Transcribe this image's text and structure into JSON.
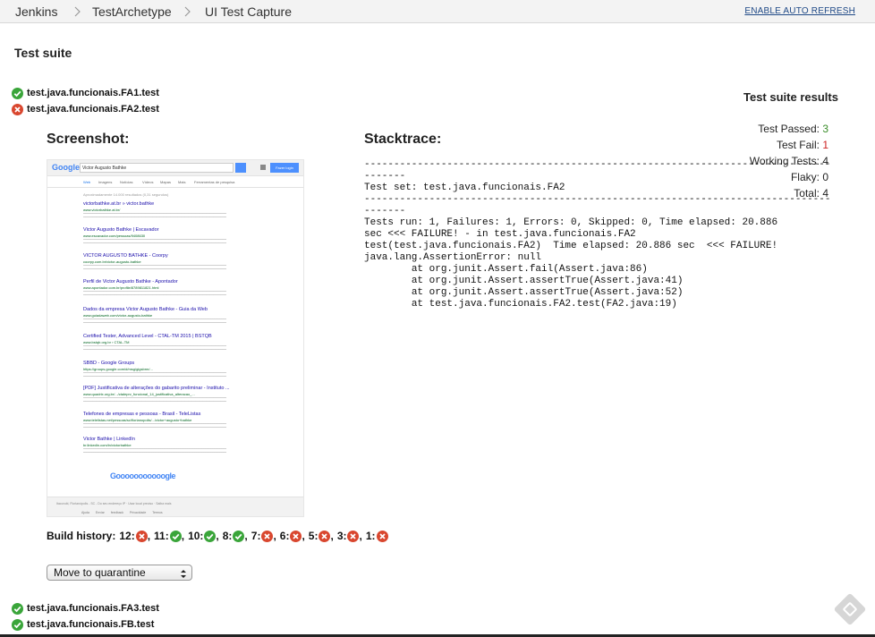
{
  "breadcrumb": {
    "items": [
      "Jenkins",
      "TestArchetype",
      "UI Test Capture"
    ],
    "auto_refresh": "ENABLE AUTO REFRESH"
  },
  "page": {
    "title": "Test suite"
  },
  "tests": [
    {
      "name": "test.java.funcionais.FA1.test",
      "status": "pass"
    },
    {
      "name": "test.java.funcionais.FA2.test",
      "status": "fail"
    },
    {
      "name": "test.java.funcionais.FA3.test",
      "status": "pass"
    },
    {
      "name": "test.java.funcionais.FB.test",
      "status": "pass"
    }
  ],
  "results": {
    "title": "Test suite results",
    "passed_label": "Test Passed:",
    "passed": "3",
    "fail_label": "Test Fail:",
    "fail": "1",
    "working_label": "Working Tests:",
    "working": "4",
    "flaky_label": "Flaky:",
    "flaky": "0",
    "total_label": "Total:",
    "total": "4"
  },
  "detail": {
    "screenshot_heading": "Screenshot:",
    "stacktrace_heading": "Stacktrace:",
    "stacktrace": "-------------------------------------------------------------------------------\n-------\nTest set: test.java.funcionais.FA2\n-------------------------------------------------------------------------------\n-------\nTests run: 1, Failures: 1, Errors: 0, Skipped: 0, Time elapsed: 20.886\nsec <<< FAILURE! - in test.java.funcionais.FA2\ntest(test.java.funcionais.FA2)  Time elapsed: 20.886 sec  <<< FAILURE!\njava.lang.AssertionError: null\n\tat org.junit.Assert.fail(Assert.java:86)\n\tat org.junit.Assert.assertTrue(Assert.java:41)\n\tat org.junit.Assert.assertTrue(Assert.java:52)\n\tat test.java.funcionais.FA2.test(FA2.java:19)",
    "build_history_label": "Build history:",
    "build_history": [
      {
        "build": "12",
        "status": "fail"
      },
      {
        "build": "11",
        "status": "pass"
      },
      {
        "build": "10",
        "status": "pass"
      },
      {
        "build": "8",
        "status": "pass"
      },
      {
        "build": "7",
        "status": "fail"
      },
      {
        "build": "6",
        "status": "fail"
      },
      {
        "build": "5",
        "status": "fail"
      },
      {
        "build": "3",
        "status": "fail"
      },
      {
        "build": "1",
        "status": "fail"
      }
    ],
    "quarantine_select": "Move to quarantine"
  },
  "screenshot_thumb": {
    "logo": "Google",
    "query": "Victor Augusto Bathke",
    "login": "Fazer login",
    "tabs": [
      "Web",
      "Imagens",
      "Notícias",
      "Vídeos",
      "Mapas",
      "Mais",
      "Ferramentas de pesquisa"
    ],
    "result_count": "Aproximadamente 14.000 resultados (0,31 segundos)",
    "results": [
      {
        "title": "victorbathke.at.br » victor.bathke",
        "url": "www.victorbathke.at.br/"
      },
      {
        "title": "Victor Augusto Bathke | Escavador",
        "url": "www.escavador.com/pessoas/9408630"
      },
      {
        "title": "VICTOR AUGUSTO BATHKE - Coorpy",
        "url": "coorpy.com.br/victor-augusto-bathke"
      },
      {
        "title": "Perfil de Victor Augusto Bathke - Apontador",
        "url": "www.apontador.com.br/profile/8789811821.html"
      },
      {
        "title": "Dados da empresa Victor Augusto Bathke - Guia da Web",
        "url": "www.guiadaweb.com/victor-augusto-bathke"
      },
      {
        "title": "Certified Tester, Advanced Level - CTAL-TM 2015 | BSTQB",
        "url": "www.bstqb.org.br › CTAL-TM"
      },
      {
        "title": "SBBD - Google Groups",
        "url": "https://groups.google.com/d/msg/gigsbrm/..."
      },
      {
        "title": "[PDF] Justificativa de alterações do gabarito preliminar - Instituto ...",
        "url": "www.quadrix.org.br/.../ctaleprv_funcional_14_justificativa_alteracao_..."
      },
      {
        "title": "Telefones de empresas e pessoas - Brasil - TeleListas",
        "url": "www.telelistas.net/pessoas/sc/florianopolis/.../victor+augusto+bathke"
      },
      {
        "title": "Victor Bathke | LinkedIn",
        "url": "br.linkedin.com/in/victorbathke"
      }
    ],
    "pager": "Gooooooooooogle",
    "footer_location": "Itacorubi, Florianópolis - SC - Do seu endereço IP · Usar local preciso · Saiba mais",
    "footer_links": "Ajuda Enviar feedback Privacidade Termos"
  },
  "colors": {
    "pass": "#3aa53a",
    "fail": "#d9472f",
    "link": "#204a87"
  },
  "icons": {
    "pass": "check-circle-icon",
    "fail": "x-circle-icon",
    "watermark": "jenkins-corner-icon"
  }
}
